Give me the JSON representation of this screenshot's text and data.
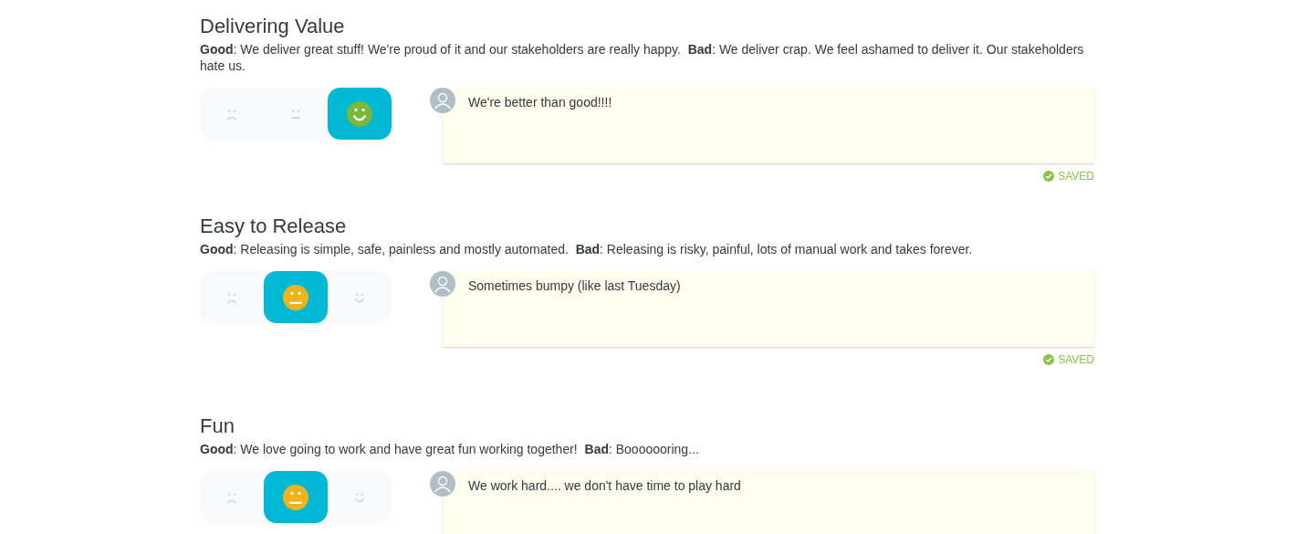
{
  "sections": [
    {
      "title": "Delivering Value",
      "description": "**Good**: We deliver great stuff! We're proud of it and our stakeholders are really happy.  **Bad**: We deliver crap. We feel ashamed to deliver it. Our stakeholders hate us.",
      "options": [
        {
          "kind": "sad",
          "selected": false
        },
        {
          "kind": "neutral",
          "selected": false
        },
        {
          "kind": "happy",
          "selected": true
        }
      ],
      "comment": "We're better than good!!!!",
      "saved": "SAVED"
    },
    {
      "title": "Easy to Release",
      "description": "**Good**: Releasing is simple, safe, painless and mostly automated.  **Bad**: Releasing is risky, painful, lots of manual work and takes forever.",
      "options": [
        {
          "kind": "sad",
          "selected": false
        },
        {
          "kind": "neutral",
          "selected": true
        },
        {
          "kind": "happy",
          "selected": false
        }
      ],
      "comment": "Sometimes bumpy (like last Tuesday)",
      "saved": "SAVED"
    },
    {
      "title": "Fun",
      "description": "**Good**: We love going to work and have great fun working together!  **Bad**: Booooooring...",
      "options": [
        {
          "kind": "sad",
          "selected": false
        },
        {
          "kind": "neutral",
          "selected": true
        },
        {
          "kind": "happy",
          "selected": false
        }
      ],
      "comment": "We work hard.... we don't have time to play hard"
    }
  ]
}
